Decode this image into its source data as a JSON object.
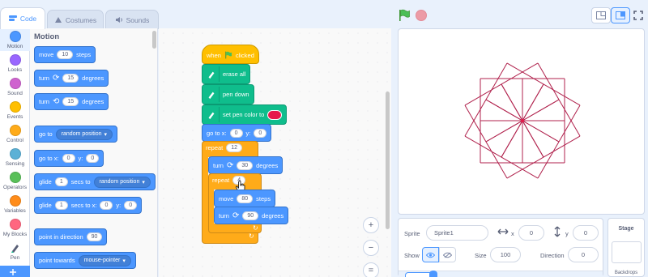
{
  "tabs": [
    {
      "label": "Code",
      "icon": "code-icon"
    },
    {
      "label": "Costumes",
      "icon": "costumes-icon"
    },
    {
      "label": "Sounds",
      "icon": "sounds-icon"
    }
  ],
  "categories": [
    {
      "label": "Motion",
      "color": "#4c97ff"
    },
    {
      "label": "Looks",
      "color": "#9966ff"
    },
    {
      "label": "Sound",
      "color": "#cf63cf"
    },
    {
      "label": "Events",
      "color": "#ffbf00"
    },
    {
      "label": "Control",
      "color": "#ffab19"
    },
    {
      "label": "Sensing",
      "color": "#5cb1d6"
    },
    {
      "label": "Operators",
      "color": "#59c059"
    },
    {
      "label": "Variables",
      "color": "#ff8c1a"
    },
    {
      "label": "My Blocks",
      "color": "#ff6680"
    },
    {
      "label": "Pen",
      "color": "#0fbd8c"
    }
  ],
  "palette": {
    "heading": "Motion",
    "move": {
      "a": "move",
      "v": "10",
      "b": "steps"
    },
    "turn_right": {
      "a": "turn",
      "v": "15",
      "b": "degrees"
    },
    "turn_left": {
      "a": "turn",
      "v": "15",
      "b": "degrees"
    },
    "goto": {
      "a": "go to",
      "dd": "random position"
    },
    "goto_xy": {
      "a": "go to x:",
      "x": "0",
      "b": "y:",
      "y": "0"
    },
    "glide": {
      "a": "glide",
      "v": "1",
      "b": "secs to",
      "dd": "random position"
    },
    "glide_xy": {
      "a": "glide",
      "v": "1",
      "b": "secs to x:",
      "x": "0",
      "c": "y:",
      "y": "0"
    },
    "point_dir": {
      "a": "point in direction",
      "v": "90"
    },
    "point_towards": {
      "a": "point towards",
      "dd": "mouse-pointer"
    }
  },
  "script": {
    "hat": {
      "a": "when",
      "b": "clicked"
    },
    "erase": "erase all",
    "pen_down": "pen down",
    "pen_color": "set pen color to",
    "pen_color_value": "#e6194b",
    "goto_xy": {
      "a": "go to x:",
      "x": "0",
      "b": "y:",
      "y": "0"
    },
    "repeat_outer": {
      "a": "repeat",
      "v": "12"
    },
    "turn1": {
      "a": "turn",
      "v": "30",
      "b": "degrees"
    },
    "repeat_inner": {
      "a": "repeat",
      "v": "4"
    },
    "move": {
      "a": "move",
      "v": "80",
      "b": "steps"
    },
    "turn2": {
      "a": "turn",
      "v": "90",
      "b": "degrees"
    }
  },
  "zoom": {
    "in": "+",
    "out": "−",
    "reset": "="
  },
  "sprite_info": {
    "sprite_label": "Sprite",
    "sprite_name": "Sprite1",
    "x_label": "x",
    "x": "0",
    "y_label": "y",
    "y": "0",
    "show_label": "Show",
    "size_label": "Size",
    "size": "100",
    "direction_label": "Direction",
    "direction": "0"
  },
  "stage_panel": {
    "title": "Stage",
    "backdrops_label": "Backdrops"
  },
  "colors": {
    "motion": "#4c97ff",
    "pen": "#0fbd8c",
    "control": "#ffab19",
    "events": "#ffbf00",
    "drawing": "#b0214c"
  }
}
